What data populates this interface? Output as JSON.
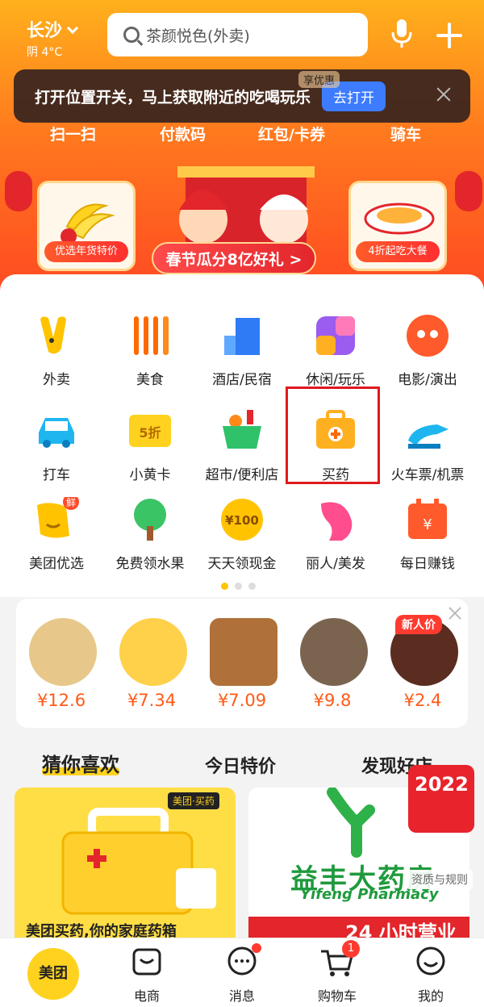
{
  "header": {
    "city": "长沙",
    "weather": "阴 4°C",
    "search_placeholder": "茶颜悦色(外卖)"
  },
  "location_prompt": {
    "text": "打开位置开关，马上获取附近的吃喝玩乐",
    "button": "去打开",
    "partial_tag": "享优惠"
  },
  "quick_actions": [
    "扫一扫",
    "付款码",
    "红包/卡券",
    "骑车"
  ],
  "promo": {
    "left_label": "优选年货特价",
    "center_label": "春节瓜分8亿好礼 >",
    "right_label": "4折起吃大餐"
  },
  "categories": [
    {
      "label": "外卖",
      "icon": "takeout-icon"
    },
    {
      "label": "美食",
      "icon": "food-icon"
    },
    {
      "label": "酒店/民宿",
      "icon": "hotel-icon"
    },
    {
      "label": "休闲/玩乐",
      "icon": "leisure-icon"
    },
    {
      "label": "电影/演出",
      "icon": "movie-icon"
    },
    {
      "label": "打车",
      "icon": "taxi-icon"
    },
    {
      "label": "小黄卡",
      "icon": "yellow-card-icon",
      "badge": "5折"
    },
    {
      "label": "超市/便利店",
      "icon": "supermarket-icon"
    },
    {
      "label": "买药",
      "icon": "medicine-box-icon"
    },
    {
      "label": "火车票/机票",
      "icon": "train-plane-icon"
    },
    {
      "label": "美团优选",
      "icon": "meituan-youxuan-icon",
      "badge": "鲜"
    },
    {
      "label": "免费领水果",
      "icon": "tree-icon"
    },
    {
      "label": "天天领现金",
      "icon": "coin-icon",
      "badge": "¥100"
    },
    {
      "label": "丽人/美发",
      "icon": "beauty-icon"
    },
    {
      "label": "每日赚钱",
      "icon": "calendar-money-icon",
      "badge": "¥"
    }
  ],
  "products": [
    {
      "price": "¥12.6"
    },
    {
      "price": "¥7.34"
    },
    {
      "price": "¥7.09"
    },
    {
      "price": "¥9.8"
    },
    {
      "price": "¥2.4"
    }
  ],
  "new_user_tag": "新人价",
  "feed_tabs": [
    "猜你喜欢",
    "今日特价",
    "发现好店"
  ],
  "feed_cards": {
    "left_brand": "美团·买药",
    "left_caption": "美团买药,你的家庭药箱",
    "right_title": "益丰大药房",
    "right_subtitle": "Yifeng Pharmacy",
    "right_hours": "24 小时营业",
    "qualification": "资质与规则"
  },
  "redpacket_year": "2022",
  "bottom_nav": {
    "home": "美团",
    "items": [
      {
        "label": "电商"
      },
      {
        "label": "消息"
      },
      {
        "label": "购物车",
        "badge": "1"
      },
      {
        "label": "我的"
      }
    ]
  },
  "colors": {
    "brand_yellow": "#ffd21f",
    "header_orange": "#ff7a1e",
    "price_orange": "#ff5a16",
    "highlight_red": "#e0191e"
  }
}
